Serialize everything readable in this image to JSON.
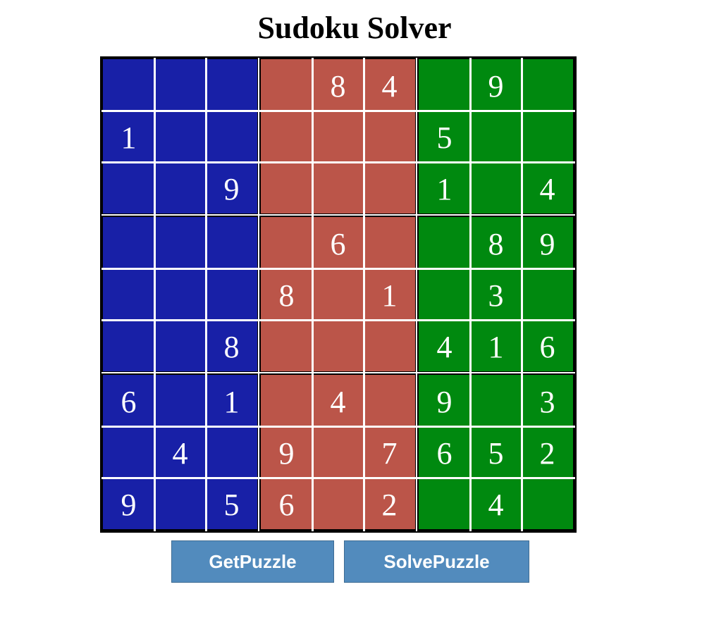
{
  "title": "Sudoku Solver",
  "box_colors": {
    "left": "#1820a7",
    "middle": "#bb5549",
    "right": "#00890f"
  },
  "grid_line_color": "#ffffff",
  "border_color": "#000000",
  "grid": [
    [
      "",
      "",
      "",
      "",
      "8",
      "4",
      "",
      "9",
      ""
    ],
    [
      "1",
      "",
      "",
      "",
      "",
      "",
      "5",
      "",
      ""
    ],
    [
      "",
      "",
      "9",
      "",
      "",
      "",
      "1",
      "",
      "4"
    ],
    [
      "",
      "",
      "",
      "",
      "6",
      "",
      "",
      "8",
      "9"
    ],
    [
      "",
      "",
      "",
      "8",
      "",
      "1",
      "",
      "3",
      ""
    ],
    [
      "",
      "",
      "8",
      "",
      "",
      "",
      "4",
      "1",
      "6"
    ],
    [
      "6",
      "",
      "1",
      "",
      "4",
      "",
      "9",
      "",
      "3"
    ],
    [
      "",
      "4",
      "",
      "9",
      "",
      "7",
      "6",
      "5",
      "2"
    ],
    [
      "9",
      "",
      "5",
      "6",
      "",
      "2",
      "",
      "4",
      ""
    ]
  ],
  "buttons": {
    "get_puzzle": "GetPuzzle",
    "solve_puzzle": "SolvePuzzle"
  }
}
